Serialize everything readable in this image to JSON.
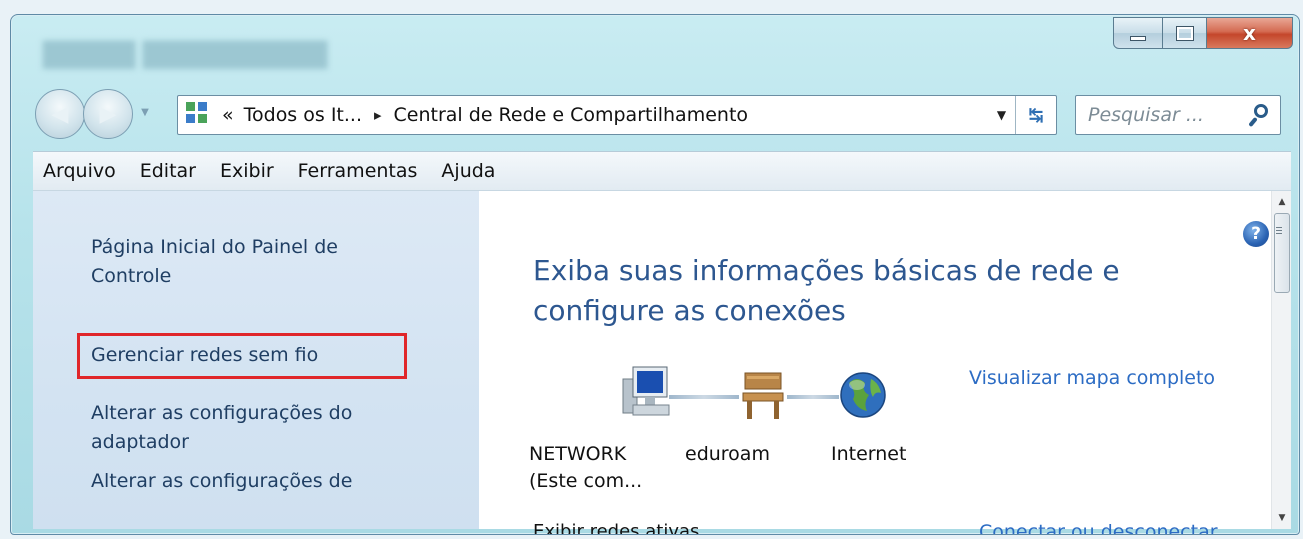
{
  "window": {
    "buttons": {
      "minimize_icon": "minimize-icon",
      "maximize_icon": "maximize-icon",
      "close_icon": "close-icon",
      "close_glyph": "x"
    }
  },
  "nav": {
    "back_icon": "back-arrow-icon",
    "forward_icon": "forward-arrow-icon",
    "address_icon": "network-folder-icon",
    "address_prefix": "«",
    "crumbs": [
      "Todos os It...",
      "Central de Rede e Compartilhamento"
    ],
    "crumb_separator": "▸",
    "dropdown_icon": "chevron-down-icon",
    "refresh_icon": "refresh-icon",
    "search_placeholder": "Pesquisar ...",
    "search_icon": "search-icon"
  },
  "menubar": {
    "items": [
      "Arquivo",
      "Editar",
      "Exibir",
      "Ferramentas",
      "Ajuda"
    ]
  },
  "sidebar": {
    "tasks": [
      "Página Inicial do Painel de Controle",
      "Gerenciar redes sem fio",
      "Alterar as configurações do adaptador",
      "Alterar as configurações de"
    ],
    "highlighted_index": 1,
    "highlight_color": "#e0262a"
  },
  "main": {
    "heading": "Exiba suas informações básicas de rede e configure as conexões",
    "help_icon": "help-icon",
    "view_map_link": "Visualizar mapa completo",
    "network_map": {
      "nodes": [
        {
          "label": "NETWORK (Este com...",
          "icon": "computer-icon"
        },
        {
          "label": "eduroam",
          "icon": "bench-icon"
        },
        {
          "label": "Internet",
          "icon": "globe-icon"
        }
      ]
    },
    "active_networks_label": "Exibir redes ativas",
    "connect_link": "Conectar ou desconectar"
  },
  "colors": {
    "link": "#2c6cc4",
    "heading": "#2d5790",
    "sidebar_link": "#1f3e63"
  }
}
